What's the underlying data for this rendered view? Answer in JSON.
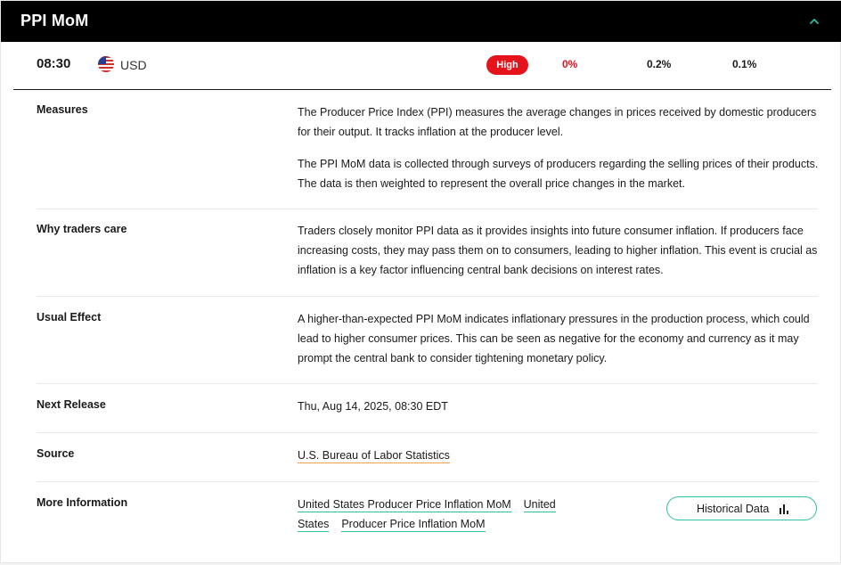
{
  "header": {
    "title": "PPI MoM",
    "collapse_icon": "chevron-up-icon"
  },
  "summary": {
    "time": "08:30",
    "flag_icon": "us-flag-icon",
    "currency": "USD",
    "impact": "High",
    "actual": "0%",
    "forecast": "0.2%",
    "previous": "0.1%"
  },
  "details": {
    "measures": {
      "label": "Measures",
      "p1": "The Producer Price Index (PPI) measures the average changes in prices received by domestic producers for their output. It tracks inflation at the producer level.",
      "p2": "The PPI MoM data is collected through surveys of producers regarding the selling prices of their products. The data is then weighted to represent the overall price changes in the market."
    },
    "why": {
      "label": "Why traders care",
      "text": "Traders closely monitor PPI data as it provides insights into future consumer inflation. If producers face increasing costs, they may pass them on to consumers, leading to higher inflation. This event is crucial as inflation is a key factor influencing central bank decisions on interest rates."
    },
    "effect": {
      "label": "Usual Effect",
      "text": "A higher-than-expected PPI MoM indicates inflationary pressures in the production process, which could lead to higher consumer prices. This can be seen as negative for the economy and currency as it may prompt the central bank to consider tightening monetary policy."
    },
    "next": {
      "label": "Next Release",
      "text": "Thu, Aug 14, 2025, 08:30 EDT"
    },
    "source": {
      "label": "Source",
      "link": "U.S. Bureau of Labor Statistics"
    },
    "more": {
      "label": "More Information",
      "link1": "United States Producer Price Inflation MoM",
      "link2a": "United",
      "link2b": "States",
      "link3": "Producer Price Inflation MoM",
      "button": "Historical Data",
      "button_icon": "bar-chart-icon"
    }
  },
  "colors": {
    "accent_teal": "#2cc0a5",
    "impact_red": "#e5131c",
    "link_underline_orange": "#f0a24a"
  }
}
